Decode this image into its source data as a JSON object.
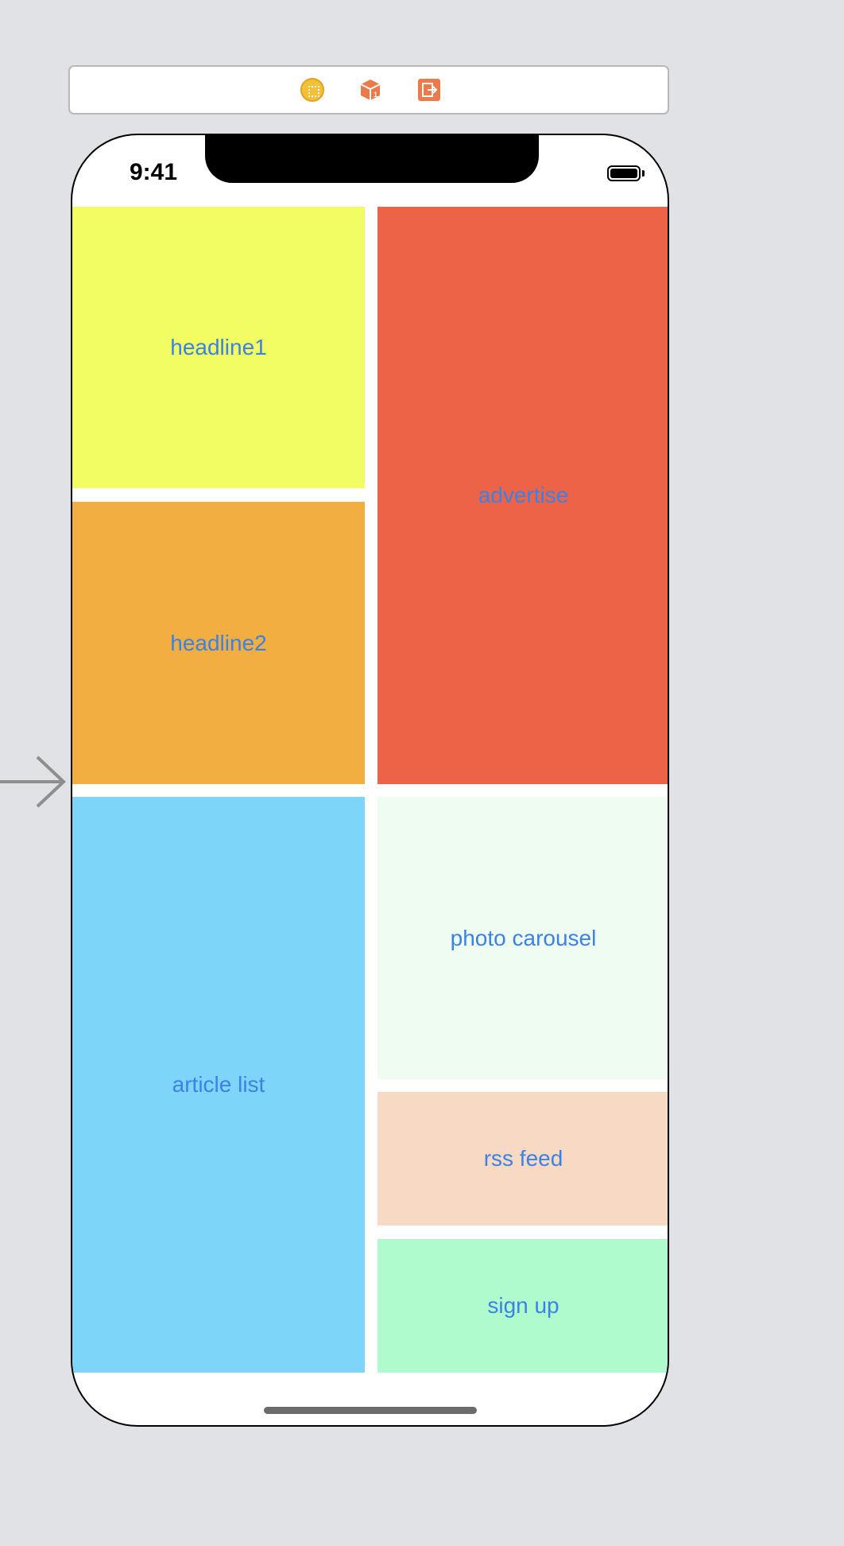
{
  "status_bar": {
    "time": "9:41",
    "battery_icon": "battery-full-icon"
  },
  "scene_dock": {
    "icons": [
      "view-controller-icon",
      "first-responder-cube-icon",
      "exit-icon"
    ],
    "colors": {
      "view_controller": "#f3c03a",
      "first_responder": "#ec7a4a",
      "exit": "#ec7a4a"
    }
  },
  "entry_point": {
    "icon": "storyboard-entry-arrow-icon",
    "color": "#8e8e8e"
  },
  "tiles": {
    "headline1": {
      "label": "headline1",
      "color": "#f1fd63"
    },
    "headline2": {
      "label": "headline2",
      "color": "#f3ae41"
    },
    "advertise": {
      "label": "advertise",
      "color": "#ec6348"
    },
    "article_list": {
      "label": "article list",
      "color": "#7dd6fa"
    },
    "photo_carousel": {
      "label": "photo carousel",
      "color": "#effcf2"
    },
    "rss_feed": {
      "label": "rss feed",
      "color": "#f8d9c4"
    },
    "sign_up": {
      "label": "sign up",
      "color": "#affbcd"
    }
  },
  "label_color": "#3b82e4"
}
